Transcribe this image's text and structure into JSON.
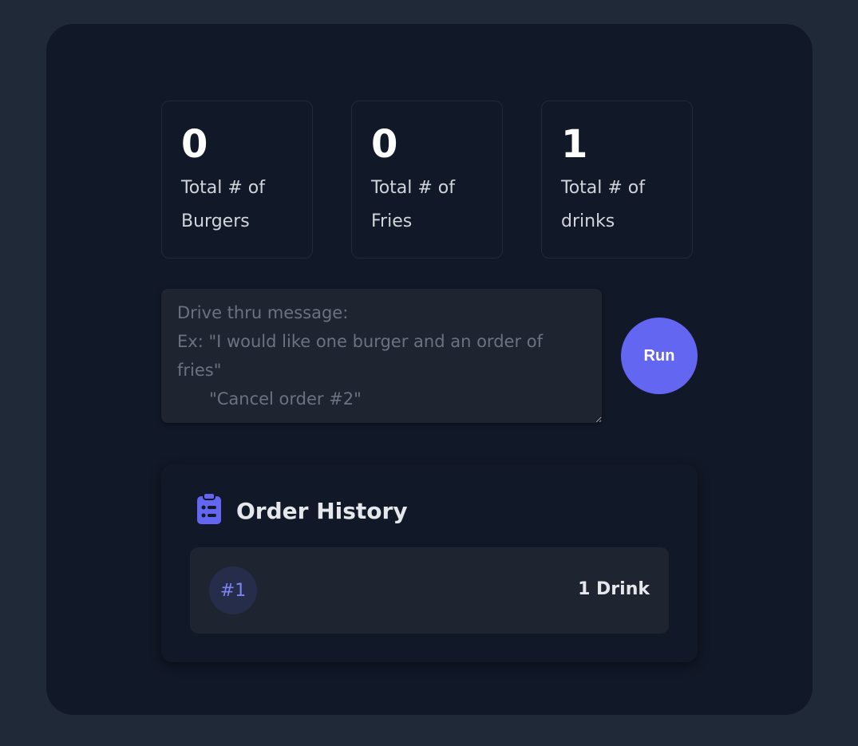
{
  "stats": [
    {
      "value": "0",
      "label_line1": "Total # of",
      "label_line2": "Burgers"
    },
    {
      "value": "0",
      "label_line1": "Total # of",
      "label_line2": "Fries"
    },
    {
      "value": "1",
      "label_line1": "Total # of",
      "label_line2": "drinks"
    }
  ],
  "input": {
    "placeholder": "Drive thru message:\nEx: \"I would like one burger and an order of fries\"\n      \"Cancel order #2\"",
    "value": ""
  },
  "run_button": {
    "label": "Run"
  },
  "history": {
    "title": "Order History",
    "icon": "clipboard-list-icon",
    "orders": [
      {
        "number": "#1",
        "summary": "1 Drink"
      }
    ]
  },
  "colors": {
    "background": "#1f2937",
    "panel": "#111827",
    "accent": "#6366f1"
  }
}
